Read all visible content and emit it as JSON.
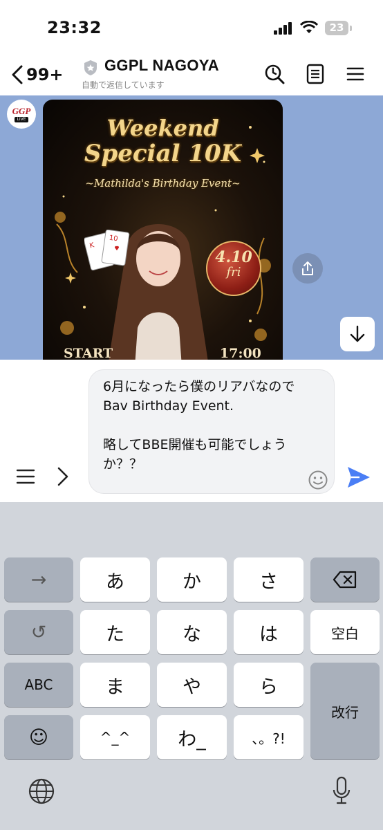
{
  "status_bar": {
    "time": "23:32",
    "battery": "23",
    "icons": [
      "signal-icon",
      "wifi-icon",
      "battery-icon"
    ]
  },
  "header": {
    "back_count": "99+",
    "title": "GGPL NAGOYA",
    "subtitle": "自動で返信しています",
    "icons": [
      "search-clock-icon",
      "notes-icon",
      "menu-icon"
    ]
  },
  "chat": {
    "background_color": "#8da8d6",
    "avatar": {
      "logo": "GGP",
      "badge": "LIVE"
    },
    "poster": {
      "title_line1": "Weekend",
      "title_line2": "Special 10K",
      "subtitle": "~Mathilda's Birthday Event~",
      "date_line1": "4.10",
      "date_line2": "fri",
      "start_label": "START",
      "start_time": "17:00"
    }
  },
  "compose": {
    "message": "6月になったら僕のリアバなのでBav Birthday Event.\n\n略してBBE開催も可能でしょうか？？",
    "accent_color": "#4a7ef5"
  },
  "keyboard": {
    "row1": [
      "→",
      "あ",
      "か",
      "さ",
      "⌫"
    ],
    "row2": [
      "↺",
      "た",
      "な",
      "は",
      "空白"
    ],
    "row3": [
      "ABC",
      "ま",
      "や",
      "ら",
      "改行"
    ],
    "row4": [
      "☺",
      "^_^",
      "わ_",
      "、。?!"
    ]
  }
}
